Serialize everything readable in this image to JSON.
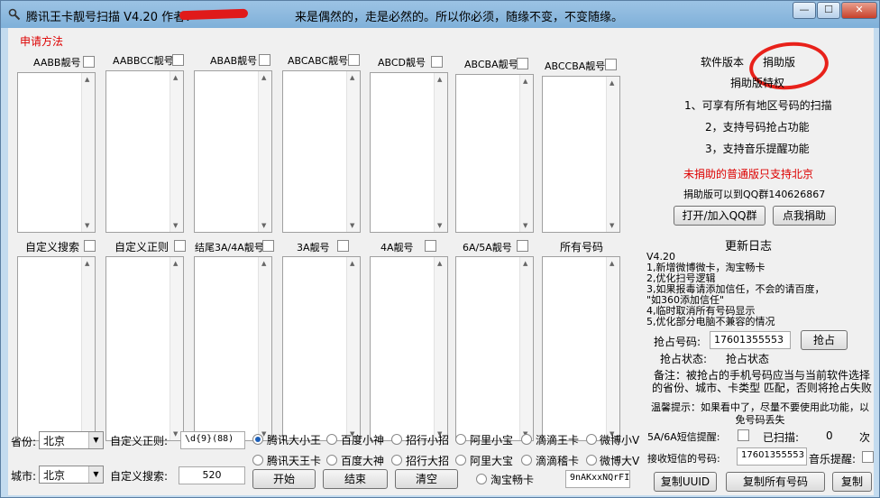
{
  "window": {
    "title": "腾讯王卡靓号扫描 V4.20 作者：",
    "slogan": "来是偶然的，走是必然的。所以你必须，随缘不变，不变随缘。",
    "buttons": [
      "—",
      "☐",
      "✕"
    ]
  },
  "apply_link": "申请方法",
  "top_categories": [
    "AABB靓号",
    "AABBCC靓号",
    "ABAB靓号",
    "ABCABC靓号",
    "ABCD靓号",
    "ABCBA靓号",
    "ABCCBA靓号"
  ],
  "bottom_categories": [
    "自定义搜索",
    "自定义正则",
    "结尾3A/4A靓号",
    "3A靓号",
    "4A靓号",
    "6A/5A靓号",
    "所有号码"
  ],
  "right": {
    "version_label": "软件版本",
    "version_value": "捐助版",
    "privilege_title": "捐助版特权",
    "privileges": [
      "1、可享有所有地区号码的扫描",
      "2，支持号码抢占功能",
      "3，支持音乐提醒功能"
    ],
    "warning": "未捐助的普通版只支持北京",
    "qq_info": "捐助版可以到QQ群140626867",
    "btn_qq": "打开/加入QQ群",
    "btn_donate": "点我捐助",
    "changelog_title": "更新日志",
    "changelog": [
      "V4.20",
      "1,新增微博微卡，淘宝畅卡",
      "2,优化扫号逻辑",
      "3,如果报毒请添加信任，不会的请百度，",
      "  \"如360添加信任\"",
      "4,临时取消所有号码显示",
      "5,优化部分电脑不兼容的情况"
    ],
    "grab_label": "抢占号码:",
    "grab_value": "17601355553",
    "grab_button": "抢占",
    "status_label": "抢占状态:",
    "status_value": "抢占状态",
    "note": "备注：被抢占的手机号码应当与当前软件选择的省份、城市、卡类型 匹配，否则将抢占失败",
    "tip": "温馨提示：如果看中了，尽量不要使用此功能，以免号码丢失",
    "sms_remind_label": "5A/6A短信提醒:",
    "scanned_label": "已扫描:",
    "scanned_value": "0",
    "times_label": "次",
    "sms_number_label": "接收短信的号码:",
    "sms_number_value": "17601355553",
    "music_label": "音乐提醒:",
    "btn_copy_uuid": "复制UUID",
    "btn_copy_all": "复制所有号码",
    "btn_copy_last": "复制"
  },
  "bottom": {
    "province_label": "省份:",
    "province_value": "北京",
    "city_label": "城市:",
    "city_value": "北京",
    "regex_label": "自定义正则:",
    "regex_value": "\\d{9}(88)",
    "search_label": "自定义搜索:",
    "search_value": "520",
    "radios_row1": [
      "腾讯大小王",
      "百度小神",
      "招行小招",
      "阿里小宝",
      "滴滴王卡",
      "微博小V"
    ],
    "radios_row2": [
      "腾讯天王卡",
      "百度大神",
      "招行大招",
      "阿里大宝",
      "滴滴稽卡",
      "微博大V"
    ],
    "radio_taobao": "淘宝畅卡",
    "btn_start": "开始",
    "btn_stop": "结束",
    "btn_clear": "清空",
    "uuid_value": "9nAKxxNQrFI"
  }
}
